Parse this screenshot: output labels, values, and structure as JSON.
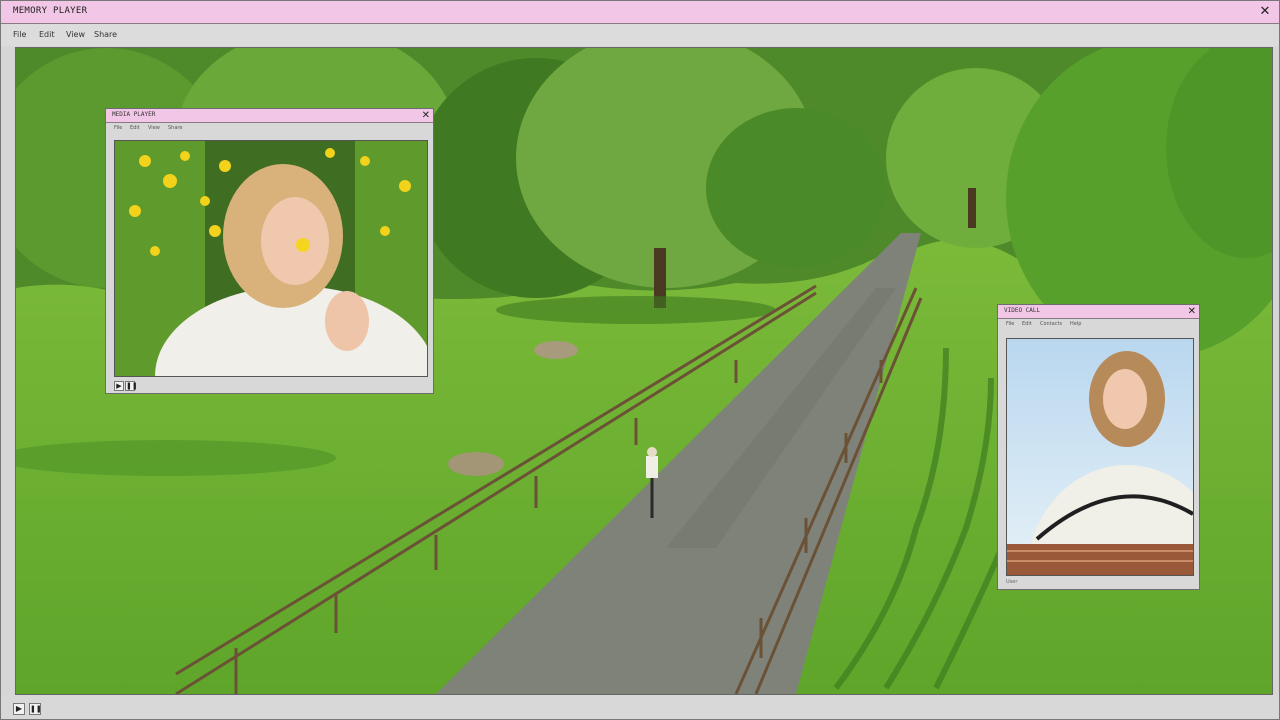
{
  "app": {
    "title": "MEMORY PLAYER",
    "close_glyph": "✕"
  },
  "menu": [
    "File",
    "Edit",
    "View",
    "Share"
  ],
  "main_video": {
    "description_icon": "landscape-scene",
    "controls": {
      "play": "▶",
      "pause": "❚❚"
    },
    "progress": 0.0
  },
  "media_player": {
    "title": "MEDIA PLAYER",
    "close_glyph": "✕",
    "menu": [
      "File",
      "Edit",
      "View",
      "Share"
    ],
    "controls": {
      "play": "▶",
      "pause": "❚❚"
    }
  },
  "video_call": {
    "title": "VIDEO CALL",
    "close_glyph": "✕",
    "menu": [
      "File",
      "Edit",
      "Contacts",
      "Help"
    ],
    "status_label": "User"
  },
  "colors": {
    "titlebar": "#f2c6e6",
    "chrome": "#d6d6d6"
  }
}
